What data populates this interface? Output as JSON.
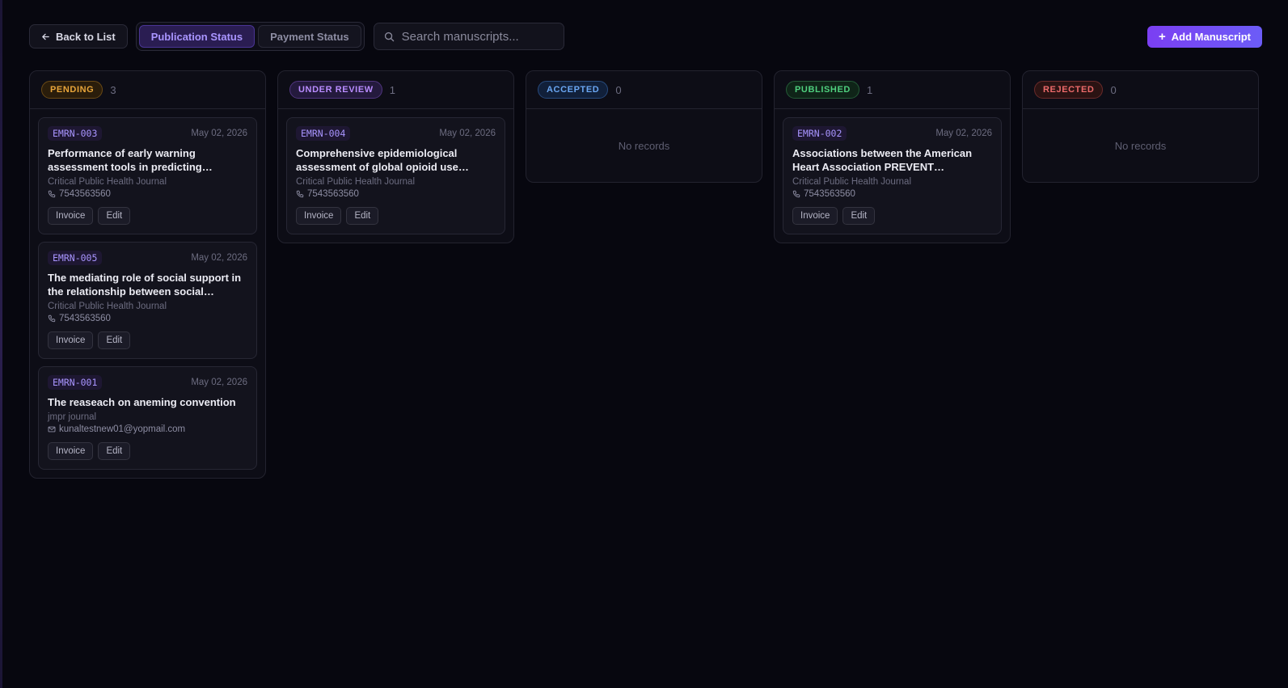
{
  "toolbar": {
    "back_label": "Back to List",
    "tabs": [
      {
        "label": "Publication Status",
        "active": true
      },
      {
        "label": "Payment Status",
        "active": false
      }
    ],
    "search_placeholder": "Search manuscripts...",
    "add_label": "Add Manuscript"
  },
  "icons": {
    "back": "arrow-left-icon",
    "search": "search-icon",
    "add": "plus-icon",
    "phone": "phone-icon",
    "email": "mail-icon"
  },
  "colors": {
    "accent": "#7b3ff2",
    "pending": "#e8a53a",
    "under_review": "#b98cff",
    "accepted": "#6aa6f2",
    "published": "#4fcf7e",
    "rejected": "#ec6a6a"
  },
  "columns": [
    {
      "status": "PENDING",
      "count": "3",
      "empty_text": "",
      "cards": [
        {
          "code": "EMRN-003",
          "date": "May 02, 2026",
          "title": "Performance of early warning assessment tools in predicting mortality",
          "journal": "Critical Public Health Journal",
          "contact": "7543563560",
          "invoice_label": "Invoice",
          "edit_label": "Edit"
        },
        {
          "code": "EMRN-005",
          "date": "May 02, 2026",
          "title": "The mediating role of social support in the relationship between social…",
          "journal": "Critical Public Health Journal",
          "contact": "7543563560",
          "invoice_label": "Invoice",
          "edit_label": "Edit"
        },
        {
          "code": "EMRN-001",
          "date": "May 02, 2026",
          "title": "The reaseach on aneming convention",
          "journal": "jmpr journal",
          "contact": "kunaltestnew01@yopmail.com",
          "invoice_label": "Invoice",
          "edit_label": "Edit"
        }
      ]
    },
    {
      "status": "UNDER REVIEW",
      "count": "1",
      "empty_text": "",
      "cards": [
        {
          "code": "EMRN-004",
          "date": "May 02, 2026",
          "title": "Comprehensive epidemiological assessment of global opioid use…",
          "journal": "Critical Public Health Journal",
          "contact": "7543563560",
          "invoice_label": "Invoice",
          "edit_label": "Edit"
        }
      ]
    },
    {
      "status": "ACCEPTED",
      "count": "0",
      "empty_text": "No records",
      "cards": []
    },
    {
      "status": "PUBLISHED",
      "count": "1",
      "empty_text": "",
      "cards": [
        {
          "code": "EMRN-002",
          "date": "May 02, 2026",
          "title": "Associations between the American Heart Association PREVENT…",
          "journal": "Critical Public Health Journal",
          "contact": "7543563560",
          "invoice_label": "Invoice",
          "edit_label": "Edit"
        }
      ]
    },
    {
      "status": "REJECTED",
      "count": "0",
      "empty_text": "No records",
      "cards": []
    }
  ]
}
